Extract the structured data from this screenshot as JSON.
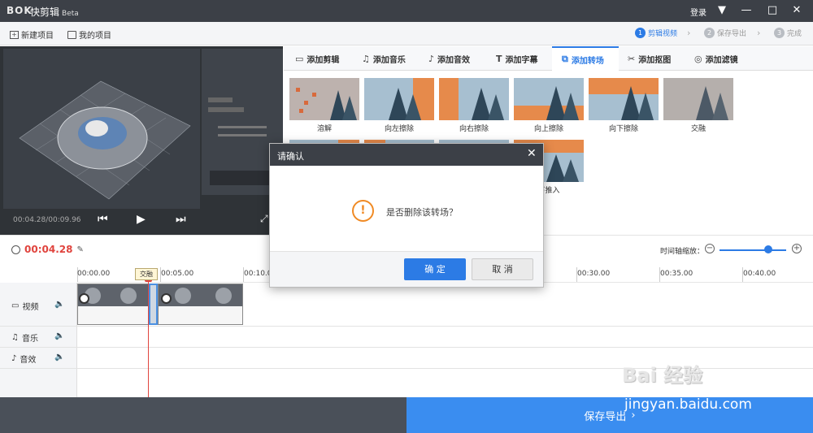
{
  "app": {
    "logo": "ΒΟΚ",
    "title": "快剪辑",
    "beta": "Beta",
    "login": "登录"
  },
  "toolbar": {
    "new_project": "新建项目",
    "my_projects": "我的项目",
    "steps": [
      {
        "num": "1",
        "label": "剪辑视频"
      },
      {
        "num": "2",
        "label": "保存导出"
      },
      {
        "num": "3",
        "label": "完成"
      }
    ]
  },
  "preview": {
    "timecode": "00:04.28/00:09.96"
  },
  "tabs": [
    {
      "icon": "▭",
      "label": "添加剪辑"
    },
    {
      "icon": "♫",
      "label": "添加音乐"
    },
    {
      "icon": "♪",
      "label": "添加音效"
    },
    {
      "icon": "T",
      "label": "添加字幕"
    },
    {
      "icon": "⧉",
      "label": "添加转场"
    },
    {
      "icon": "✂",
      "label": "添加抠图"
    },
    {
      "icon": "◎",
      "label": "添加滤镜"
    }
  ],
  "transitions": [
    {
      "label": "溶解"
    },
    {
      "label": "向左擦除"
    },
    {
      "label": "向右擦除"
    },
    {
      "label": "向上擦除"
    },
    {
      "label": "向下擦除"
    },
    {
      "label": "交融"
    },
    {
      "label": ""
    },
    {
      "label": ""
    },
    {
      "label": ""
    },
    {
      "label": "下推入"
    }
  ],
  "timeline": {
    "current_time": "00:04.28",
    "zoom_label": "时间轴缩放：",
    "zoom_level": 0.73,
    "ruler": [
      "00:00.00",
      "00:05.00",
      "00:10.00",
      "00:30.00",
      "00:35.00",
      "00:40.00"
    ],
    "tooltip": "交融",
    "tracks": [
      {
        "icon": "▭",
        "label": "视频"
      },
      {
        "icon": "♫",
        "label": "音乐"
      },
      {
        "icon": "♪",
        "label": "音效"
      }
    ]
  },
  "bottom": {
    "save_export": "保存导出"
  },
  "dialog": {
    "title": "请确认",
    "message": "是否删除该转场？",
    "ok": "确 定",
    "cancel": "取 消"
  },
  "watermark": {
    "brand": "Bai 经验",
    "url": "jingyan.baidu.com"
  }
}
